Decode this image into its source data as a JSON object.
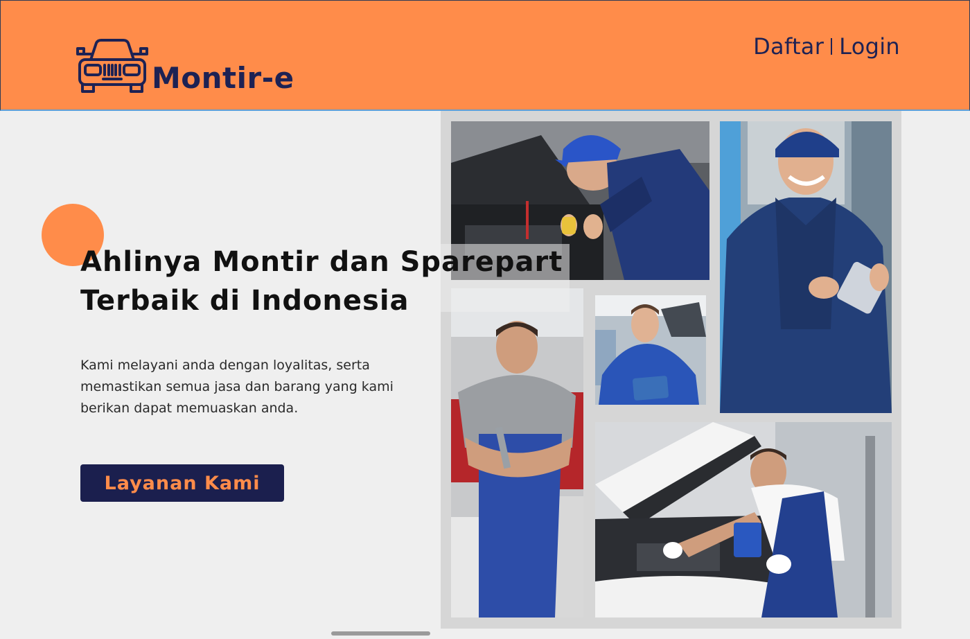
{
  "header": {
    "brand": "Montir-e",
    "logo_icon": "car-front-icon",
    "register_label": "Daftar",
    "login_label": "Login"
  },
  "hero": {
    "title_line1": "Ahlinya Montir dan Sparepart",
    "title_line2": "Terbaik di Indonesia",
    "description_line1": "Kami melayani anda dengan loyalitas, serta",
    "description_line2": "memastikan semua jasa dan barang yang kami",
    "description_line3": "berikan dapat memuaskan anda.",
    "cta_label": "Layanan Kami"
  },
  "colors": {
    "brand_orange": "#ff8c4a",
    "navy": "#1b1f4e",
    "page_background": "#efefef",
    "gallery_background": "#d6d6d6"
  }
}
